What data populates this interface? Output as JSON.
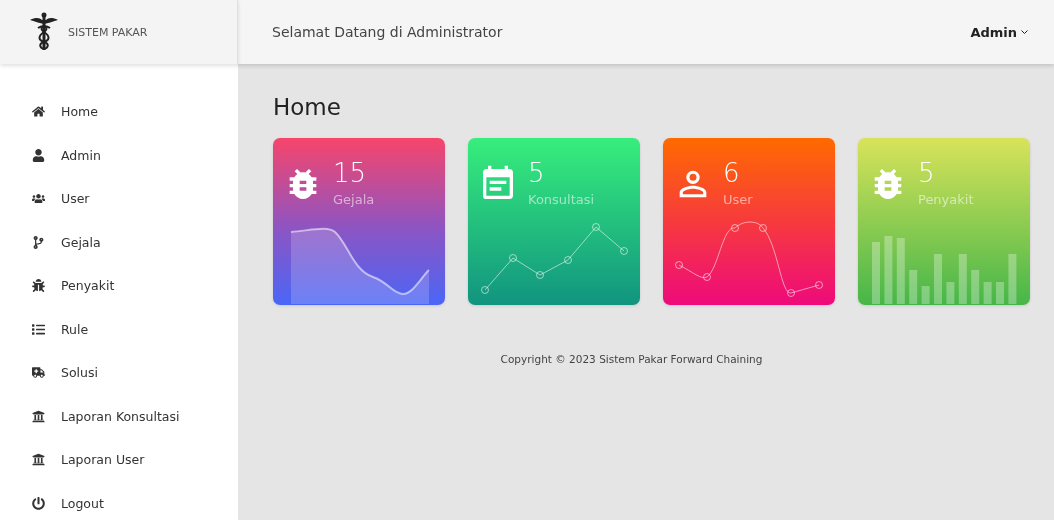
{
  "brand": {
    "title": "SISTEM PAKAR"
  },
  "header": {
    "greeting": "Selamat Datang di Administrator",
    "user_menu": "Admin"
  },
  "sidebar": {
    "items": [
      {
        "label": "Home"
      },
      {
        "label": "Admin"
      },
      {
        "label": "User"
      },
      {
        "label": "Gejala"
      },
      {
        "label": "Penyakit"
      },
      {
        "label": "Rule"
      },
      {
        "label": "Solusi"
      },
      {
        "label": "Laporan Konsultasi"
      },
      {
        "label": "Laporan User"
      },
      {
        "label": "Logout"
      }
    ]
  },
  "page_title": "Home",
  "cards": [
    {
      "count": "15",
      "label": "Gejala",
      "kind": "area"
    },
    {
      "count": "5",
      "label": "Konsultasi",
      "kind": "line"
    },
    {
      "count": "6",
      "label": "User",
      "kind": "curve"
    },
    {
      "count": "5",
      "label": "Penyakit",
      "kind": "bar"
    }
  ],
  "footer": "Copyright © 2023 Sistem Pakar Forward Chaining"
}
